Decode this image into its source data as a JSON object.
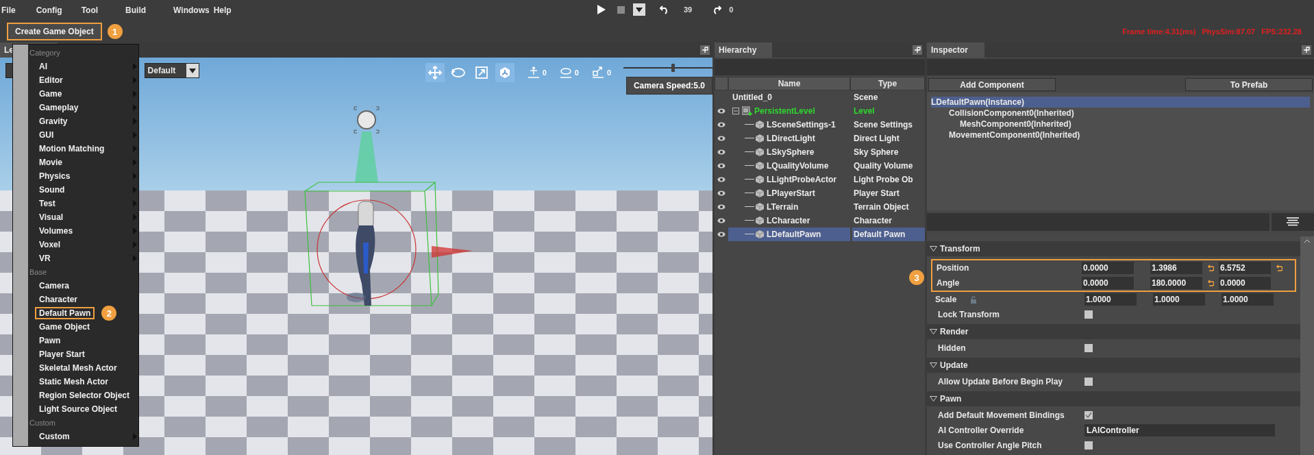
{
  "menu_bar": [
    "File",
    "Config",
    "Tool",
    "Build",
    "Windows",
    "Help"
  ],
  "playback": {
    "undo_count": "39",
    "redo_count": "0"
  },
  "toolbar": {
    "create_button": {
      "label": "Create Game Object",
      "badge": "1"
    },
    "stats": "Frame time:4.31(ms)   PhysSim:87.07   FPS:232.28"
  },
  "viewport": {
    "tab": "Le",
    "view_mode": "Default",
    "tools": [
      {
        "kind": "move",
        "selected": true
      },
      {
        "kind": "rotate",
        "selected": false
      },
      {
        "kind": "scale",
        "selected": false
      },
      {
        "kind": "space",
        "selected": true
      }
    ],
    "snaps": [
      {
        "kind": "move",
        "value": "0"
      },
      {
        "kind": "rotate",
        "value": "0"
      },
      {
        "kind": "scale",
        "value": "0"
      }
    ],
    "camera_speed": {
      "label": "Camera Speed:5.0",
      "level": 0.55
    }
  },
  "create_menu": {
    "sections": [
      {
        "title": "Category",
        "items": [
          {
            "label": "AI",
            "submenu": true
          },
          {
            "label": "Editor",
            "submenu": true
          },
          {
            "label": "Game",
            "submenu": true
          },
          {
            "label": "Gameplay",
            "submenu": true
          },
          {
            "label": "Gravity",
            "submenu": true
          },
          {
            "label": "GUI",
            "submenu": true
          },
          {
            "label": "Motion Matching",
            "submenu": true
          },
          {
            "label": "Movie",
            "submenu": true
          },
          {
            "label": "Physics",
            "submenu": true
          },
          {
            "label": "Sound",
            "submenu": true
          },
          {
            "label": "Test",
            "submenu": true
          },
          {
            "label": "Visual",
            "submenu": true
          },
          {
            "label": "Volumes",
            "submenu": true
          },
          {
            "label": "Voxel",
            "submenu": true
          },
          {
            "label": "VR",
            "submenu": true
          }
        ]
      },
      {
        "title": "Base",
        "items": [
          {
            "label": "Camera",
            "submenu": false
          },
          {
            "label": "Character",
            "submenu": false
          },
          {
            "label": "Default Pawn",
            "submenu": false,
            "badge": "2"
          },
          {
            "label": "Game Object",
            "submenu": false
          },
          {
            "label": "Pawn",
            "submenu": false
          },
          {
            "label": "Player Start",
            "submenu": false
          },
          {
            "label": "Skeletal Mesh Actor",
            "submenu": false
          },
          {
            "label": "Static Mesh Actor",
            "submenu": false
          },
          {
            "label": "Region Selector Object",
            "submenu": false
          },
          {
            "label": "Light Source Object",
            "submenu": false
          }
        ]
      },
      {
        "title": "Custom",
        "items": [
          {
            "label": "Custom",
            "submenu": true
          }
        ]
      }
    ]
  },
  "hierarchy": {
    "title": "Hierarchy",
    "columns": [
      "Name",
      "Type"
    ],
    "root": {
      "name": "Untitled_0",
      "type": "Scene",
      "visible": false
    },
    "level": {
      "name": "PersistentLevel",
      "type": "Level",
      "visible": true,
      "active": true,
      "expanded": true,
      "children": [
        {
          "name": "LSceneSettings-1",
          "type": "Scene Settings",
          "visible": true,
          "selected": false
        },
        {
          "name": "LDirectLight",
          "type": "Direct Light",
          "visible": true,
          "selected": false
        },
        {
          "name": "LSkySphere",
          "type": "Sky Sphere",
          "visible": true,
          "selected": false
        },
        {
          "name": "LQualityVolume",
          "type": "Quality Volume",
          "visible": true,
          "selected": false
        },
        {
          "name": "LLightProbeActor",
          "type": "Light Probe Ob",
          "visible": true,
          "selected": false
        },
        {
          "name": "LPlayerStart",
          "type": "Player Start",
          "visible": true,
          "selected": false
        },
        {
          "name": "LTerrain",
          "type": "Terrain Object",
          "visible": true,
          "selected": false
        },
        {
          "name": "LCharacter",
          "type": "Character",
          "visible": true,
          "selected": false
        },
        {
          "name": "LDefaultPawn",
          "type": "Default Pawn",
          "visible": true,
          "selected": true
        }
      ]
    }
  },
  "inspector": {
    "title": "Inspector",
    "add_button": "Add Component",
    "prefab_button": "To Prefab",
    "components": [
      {
        "label": "LDefaultPawn(Instance)",
        "selected": true,
        "children": [
          {
            "label": "CollisionComponent0(Inherited)",
            "selected": false,
            "children": [
              {
                "label": "MeshComponent0(Inherited)",
                "selected": false
              }
            ]
          },
          {
            "label": "MovementComponent0(Inherited)",
            "selected": false
          }
        ]
      }
    ],
    "sections": [
      {
        "title": "Transform",
        "expanded": true,
        "callout": {
          "badge": "3",
          "rows": [
            {
              "kind": "vector",
              "label": "Position",
              "values": [
                {
                  "value": "0.0000",
                  "modified": false
                },
                {
                  "value": "1.3986",
                  "modified": true
                },
                {
                  "value": "6.5752",
                  "modified": true
                }
              ]
            },
            {
              "kind": "vector",
              "label": "Angle",
              "values": [
                {
                  "value": "0.0000",
                  "modified": false
                },
                {
                  "value": "180.0000",
                  "modified": true
                },
                {
                  "value": "0.0000",
                  "modified": false
                }
              ]
            }
          ]
        },
        "rows": [
          {
            "kind": "vector",
            "label": "Scale",
            "locked": false,
            "values": [
              {
                "value": "1.0000",
                "modified": false
              },
              {
                "value": "1.0000",
                "modified": false
              },
              {
                "value": "1.0000",
                "modified": false
              }
            ]
          },
          {
            "kind": "checkbox",
            "label": "Lock Transform",
            "checked": false
          }
        ]
      },
      {
        "title": "Render",
        "expanded": true,
        "rows": [
          {
            "kind": "checkbox",
            "label": "Hidden",
            "checked": false
          }
        ]
      },
      {
        "title": "Update",
        "expanded": true,
        "rows": [
          {
            "kind": "checkbox",
            "label": "Allow Update Before Begin Play",
            "checked": false
          }
        ]
      },
      {
        "title": "Pawn",
        "expanded": true,
        "rows": [
          {
            "kind": "checkbox",
            "label": "Add Default Movement Bindings",
            "checked": true
          },
          {
            "kind": "text",
            "label": "AI Controller Override",
            "value": "LAIController"
          },
          {
            "kind": "checkbox",
            "label": "Use Controller Angle Pitch",
            "checked": false
          }
        ]
      }
    ]
  }
}
